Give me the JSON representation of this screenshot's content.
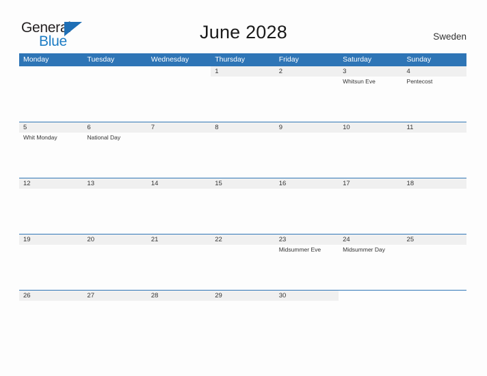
{
  "brand": {
    "name_part1": "General",
    "name_part2": "Blue",
    "logo_icon": "sail-triangle-icon"
  },
  "header": {
    "title": "June 2028",
    "country": "Sweden"
  },
  "colors": {
    "header_blue": "#2E75B6",
    "date_band_gray": "#F0F0F0",
    "brand_blue": "#1C7CC4",
    "text": "#333333",
    "page_background": "#FDFDFD"
  },
  "calendar": {
    "month": "June",
    "year": "2028",
    "weekday_headers": [
      "Monday",
      "Tuesday",
      "Wednesday",
      "Thursday",
      "Friday",
      "Saturday",
      "Sunday"
    ],
    "weeks": [
      [
        {
          "date": "",
          "events": []
        },
        {
          "date": "",
          "events": []
        },
        {
          "date": "",
          "events": []
        },
        {
          "date": "1",
          "events": []
        },
        {
          "date": "2",
          "events": []
        },
        {
          "date": "3",
          "events": [
            "Whitsun Eve"
          ]
        },
        {
          "date": "4",
          "events": [
            "Pentecost"
          ]
        }
      ],
      [
        {
          "date": "5",
          "events": [
            "Whit Monday"
          ]
        },
        {
          "date": "6",
          "events": [
            "National Day"
          ]
        },
        {
          "date": "7",
          "events": []
        },
        {
          "date": "8",
          "events": []
        },
        {
          "date": "9",
          "events": []
        },
        {
          "date": "10",
          "events": []
        },
        {
          "date": "11",
          "events": []
        }
      ],
      [
        {
          "date": "12",
          "events": []
        },
        {
          "date": "13",
          "events": []
        },
        {
          "date": "14",
          "events": []
        },
        {
          "date": "15",
          "events": []
        },
        {
          "date": "16",
          "events": []
        },
        {
          "date": "17",
          "events": []
        },
        {
          "date": "18",
          "events": []
        }
      ],
      [
        {
          "date": "19",
          "events": []
        },
        {
          "date": "20",
          "events": []
        },
        {
          "date": "21",
          "events": []
        },
        {
          "date": "22",
          "events": []
        },
        {
          "date": "23",
          "events": [
            "Midsummer Eve"
          ]
        },
        {
          "date": "24",
          "events": [
            "Midsummer Day"
          ]
        },
        {
          "date": "25",
          "events": []
        }
      ],
      [
        {
          "date": "26",
          "events": []
        },
        {
          "date": "27",
          "events": []
        },
        {
          "date": "28",
          "events": []
        },
        {
          "date": "29",
          "events": []
        },
        {
          "date": "30",
          "events": []
        },
        {
          "date": "",
          "events": []
        },
        {
          "date": "",
          "events": []
        }
      ]
    ]
  }
}
